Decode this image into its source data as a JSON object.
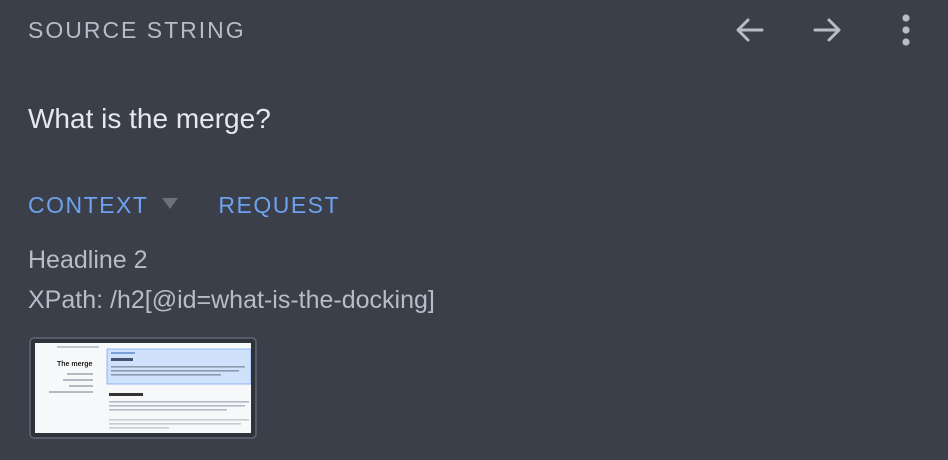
{
  "header": {
    "label": "SOURCE STRING",
    "prev_icon": "arrow-left-icon",
    "next_icon": "arrow-right-icon",
    "more_icon": "more-vertical-icon"
  },
  "source": {
    "text": "What is the merge?"
  },
  "tabs": [
    {
      "label": "CONTEXT",
      "has_dropdown": true
    },
    {
      "label": "REQUEST",
      "has_dropdown": false
    }
  ],
  "context": {
    "element_type": "Headline 2",
    "xpath": "XPath: /h2[@id=what-is-the-docking]"
  },
  "screenshot_thumb": {
    "heading": "The merge"
  },
  "colors": {
    "background": "#3a3f4a",
    "accent": "#6ea2ee",
    "muted_text": "#b7bcc6",
    "primary_text": "#e6e8ec"
  }
}
